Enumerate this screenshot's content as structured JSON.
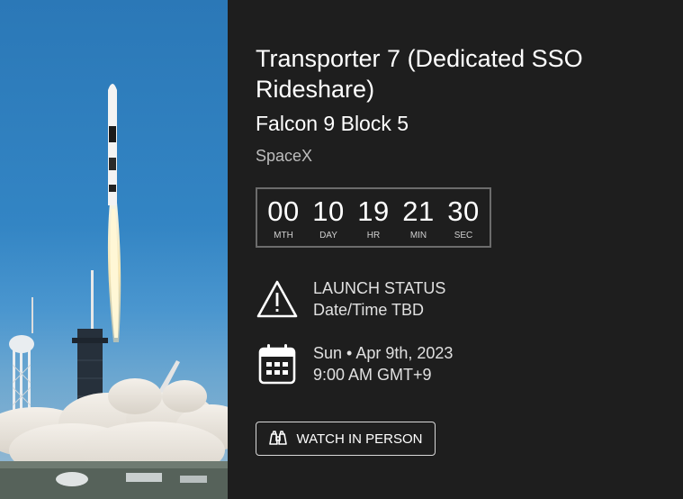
{
  "launch": {
    "title": "Transporter 7 (Dedicated SSO Rideshare)",
    "vehicle": "Falcon 9 Block 5",
    "provider": "SpaceX"
  },
  "countdown": [
    {
      "value": "00",
      "label": "MTH"
    },
    {
      "value": "10",
      "label": "DAY"
    },
    {
      "value": "19",
      "label": "HR"
    },
    {
      "value": "21",
      "label": "MIN"
    },
    {
      "value": "30",
      "label": "SEC"
    }
  ],
  "status": {
    "heading": "LAUNCH STATUS",
    "value": "Date/Time TBD",
    "icon": "warning-icon"
  },
  "date": {
    "day": "Sun • Apr 9th, 2023",
    "time": "9:00 AM GMT+9",
    "icon": "calendar-icon"
  },
  "watch_button": {
    "label": "WATCH IN PERSON",
    "icon": "binoculars-icon"
  },
  "colors": {
    "background": "#1e1e1e",
    "countdown_border": "#6c6c6c",
    "secondary_text": "#bdbdbd"
  }
}
